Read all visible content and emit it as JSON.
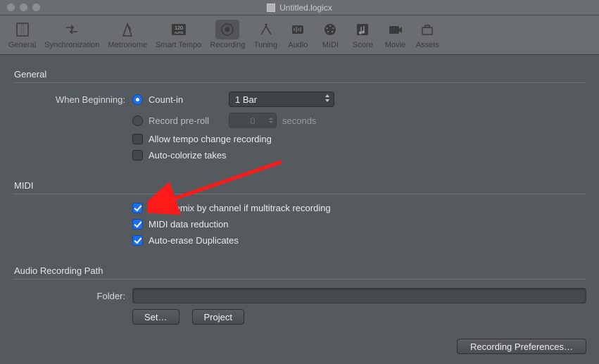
{
  "window": {
    "title": "Untitled.logicx"
  },
  "toolbar": {
    "items": [
      {
        "label": "General"
      },
      {
        "label": "Synchronization"
      },
      {
        "label": "Metronome"
      },
      {
        "label": "Smart Tempo"
      },
      {
        "label": "Recording"
      },
      {
        "label": "Tuning"
      },
      {
        "label": "Audio"
      },
      {
        "label": "MIDI"
      },
      {
        "label": "Score"
      },
      {
        "label": "Movie"
      },
      {
        "label": "Assets"
      }
    ],
    "active_index": 4
  },
  "sections": {
    "general": {
      "title": "General",
      "when_beginning_label": "When Beginning:",
      "count_in_label": "Count-in",
      "bar_select": "1 Bar",
      "pre_roll_label": "Record pre-roll",
      "pre_roll_value": "0",
      "pre_roll_unit": "seconds",
      "allow_tempo_label": "Allow tempo change recording",
      "auto_colorize_label": "Auto-colorize takes"
    },
    "midi": {
      "title": "MIDI",
      "auto_demix_label": "Auto demix by channel if multitrack recording",
      "midi_reduction_label": "MIDI data reduction",
      "auto_erase_label": "Auto-erase Duplicates"
    },
    "audio_path": {
      "title": "Audio Recording Path",
      "folder_label": "Folder:",
      "folder_value": "",
      "set_label": "Set…",
      "project_label": "Project"
    }
  },
  "footer": {
    "recording_prefs_label": "Recording Preferences…"
  }
}
